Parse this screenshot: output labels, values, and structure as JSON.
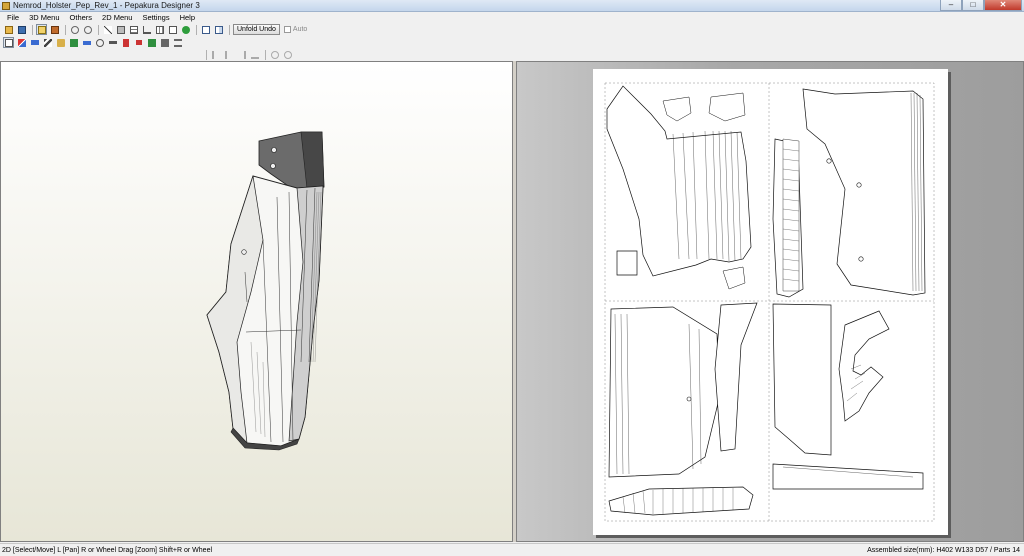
{
  "window": {
    "title": "Nemrod_Holster_Pep_Rev_1 - Pepakura Designer 3",
    "controls": {
      "minimize": "–",
      "maximize": "□",
      "close": "✕"
    }
  },
  "menu": {
    "items": [
      "File",
      "3D Menu",
      "Others",
      "2D Menu",
      "Settings",
      "Help"
    ]
  },
  "toolbar": {
    "unfold_undo_label": "Unfold Undo",
    "auto_label": "Auto",
    "row1_icons": [
      "open-icon",
      "save-icon",
      "pointer-icon",
      "box-icon",
      "undo-icon",
      "redo-icon",
      "pen-icon",
      "cube-icon",
      "layers-icon",
      "anchor-icon",
      "grid-icon",
      "text-icon",
      "globe-icon",
      "window-icon",
      "window-split-icon"
    ],
    "row2_icons": [
      "select-icon",
      "fold-icon",
      "bar-icon",
      "join-icon",
      "paint-icon",
      "flag-icon",
      "scissors-icon",
      "rotate-icon",
      "align-icon",
      "tab-icon",
      "tab2-icon",
      "plane-icon",
      "move-icon",
      "stack-icon"
    ],
    "row3_icons": [
      "align-left-icon",
      "align-center-icon",
      "align-right-icon",
      "align-bottom-icon",
      "loop-icon",
      "loop2-icon"
    ]
  },
  "colors": {
    "view3d_top": "#ffffff",
    "view3d_bottom": "#e7e6d7",
    "view2d_bg": "#a9a9a9",
    "model_dark_face": "#6b6b6b"
  },
  "status": {
    "left": "2D [Select/Move] L [Pan] R or Wheel Drag [Zoom] Shift+R or Wheel",
    "right": "Assembled size(mm): H402 W133 D57 / Parts 14"
  }
}
